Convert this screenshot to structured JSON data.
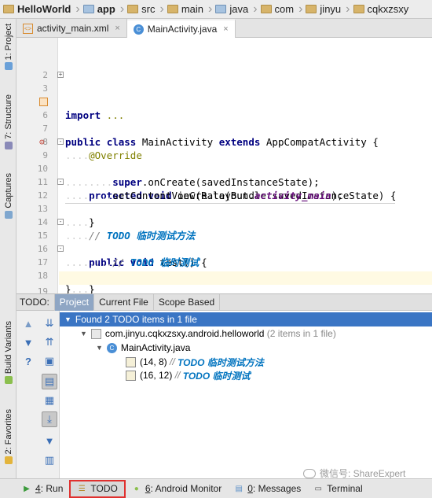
{
  "breadcrumb": [
    "HelloWorld",
    "app",
    "src",
    "main",
    "java",
    "com",
    "jinyu",
    "cqkxzsxy"
  ],
  "left_strip": {
    "project_label": "1: Project",
    "structure_label": "7: Structure",
    "captures_label": "Captures",
    "build_variants_label": "Build Variants",
    "favorites_label": "2: Favorites"
  },
  "tabs": [
    {
      "label": "activity_main.xml",
      "close": "×"
    },
    {
      "label": "MainActivity.java",
      "close": "×"
    }
  ],
  "editor": {
    "line_numbers": [
      "2",
      "3",
      "6",
      "7",
      "8",
      "9",
      "10",
      "11",
      "12",
      "13",
      "14",
      "15",
      "16",
      "17",
      "18",
      "19"
    ],
    "l3_kw": "import",
    "l3_rest": " ...",
    "l6_kw1": "public",
    "l6_kw2": "class",
    "l6_name": " MainActivity ",
    "l6_kw3": "extends",
    "l6_rest": " AppCompatActivity {",
    "l8_ann": "@Override",
    "l9_kw1": "protected",
    "l9_kw2": "void",
    "l9_rest": " onCreate(Bundle savedInstanceState) {",
    "l10_kw": "super",
    "l10_rest": ".onCreate(savedInstanceState);",
    "l11_pre": "setContentView(R.layout.",
    "l11_ital": "activity_main",
    "l11_post": ");",
    "l12": "}",
    "l14_cmt": "// ",
    "l14_todo": "TODO 临时测试方法",
    "l15_kw1": "public",
    "l15_kw2": "void",
    "l15_rest": " test() {",
    "l16_cmt": "// ",
    "l16_todo": "TODO 临时测试",
    "l17": "}",
    "l18": "}"
  },
  "todo_panel": {
    "title": "TODO:",
    "tabs": [
      "Project",
      "Current File",
      "Scope Based"
    ],
    "summary": "Found 2 TODO items in 1 file",
    "package": "com.jinyu.cqkxzsxy.android.helloworld",
    "package_count": "(2 items in 1 file)",
    "file": "MainActivity.java",
    "items": [
      {
        "pos": "(14, 8)",
        "prefix": "//",
        "text": "TODO 临时测试方法"
      },
      {
        "pos": "(16, 12)",
        "prefix": "//",
        "text": "TODO 临时测试"
      }
    ]
  },
  "bottom_bar": {
    "run_num": "4",
    "run_label": ": Run",
    "todo_label": "TODO",
    "android_num": "6",
    "android_label": ": Android Monitor",
    "messages_num": "0",
    "messages_label": ": Messages",
    "terminal_label": "Terminal"
  },
  "watermark": "微信号: ShareExpert",
  "colors": {
    "keyword": "#000080",
    "annotation": "#808000",
    "todo": "#0073bf",
    "selection": "#3a75c4",
    "highlight_border": "#e0302e"
  }
}
